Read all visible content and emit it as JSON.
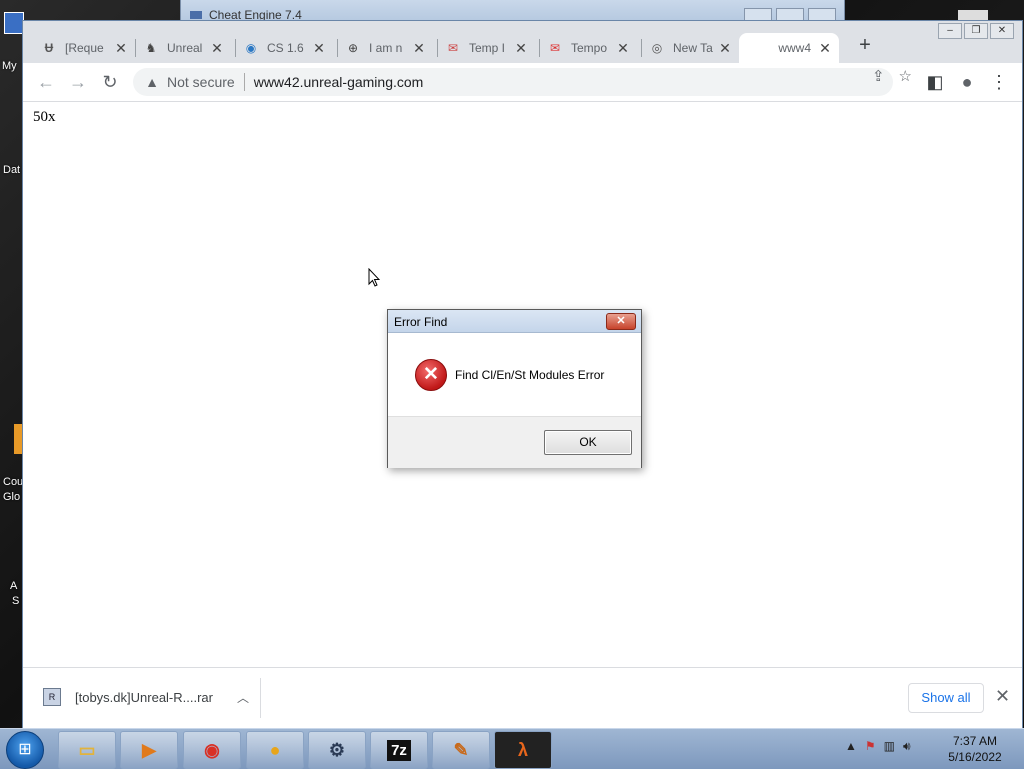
{
  "desktop": {
    "labels": [
      "My",
      "Dat",
      "Cou",
      "Glo",
      "A",
      "S"
    ]
  },
  "background_window": {
    "title": "Cheat Engine 7.4"
  },
  "browser": {
    "tabs": [
      {
        "label": "[Reque",
        "favicon": "uc-logo-icon"
      },
      {
        "label": "Unreal",
        "favicon": "cs-player-icon"
      },
      {
        "label": "CS 1.6",
        "favicon": "gamepad-icon"
      },
      {
        "label": "I am n",
        "favicon": "globe-icon"
      },
      {
        "label": "Temp I",
        "favicon": "mail-icon"
      },
      {
        "label": "Tempo",
        "favicon": "temp-mail-icon"
      },
      {
        "label": "New Ta",
        "favicon": "chrome-icon"
      },
      {
        "label": "www4",
        "favicon": "blank-icon",
        "active": true
      }
    ],
    "omnibox": {
      "security_label": "Not secure",
      "url": "www42.unreal-gaming.com"
    },
    "page": {
      "text": "50x"
    },
    "downloads": {
      "filename": "[tobys.dk]Unreal-R....rar",
      "show_all_label": "Show all"
    }
  },
  "dialog": {
    "title": "Error Find",
    "message": "Find Cl/En/St Modules Error",
    "ok_label": "OK",
    "icon": "error-icon"
  },
  "taskbar": {
    "apps": [
      "file-explorer-icon",
      "media-player-icon",
      "chrome-icon",
      "gso-icon",
      "cheat-engine-icon",
      "7zip-icon",
      "tool-icon",
      "half-life-icon"
    ],
    "seven_zip_label": "7z",
    "clock_time": "7:37 AM",
    "clock_date": "5/16/2022"
  },
  "colors": {
    "taskbar": "#8ba5c8",
    "link_blue": "#1a73e8",
    "error_red": "#c01818"
  }
}
